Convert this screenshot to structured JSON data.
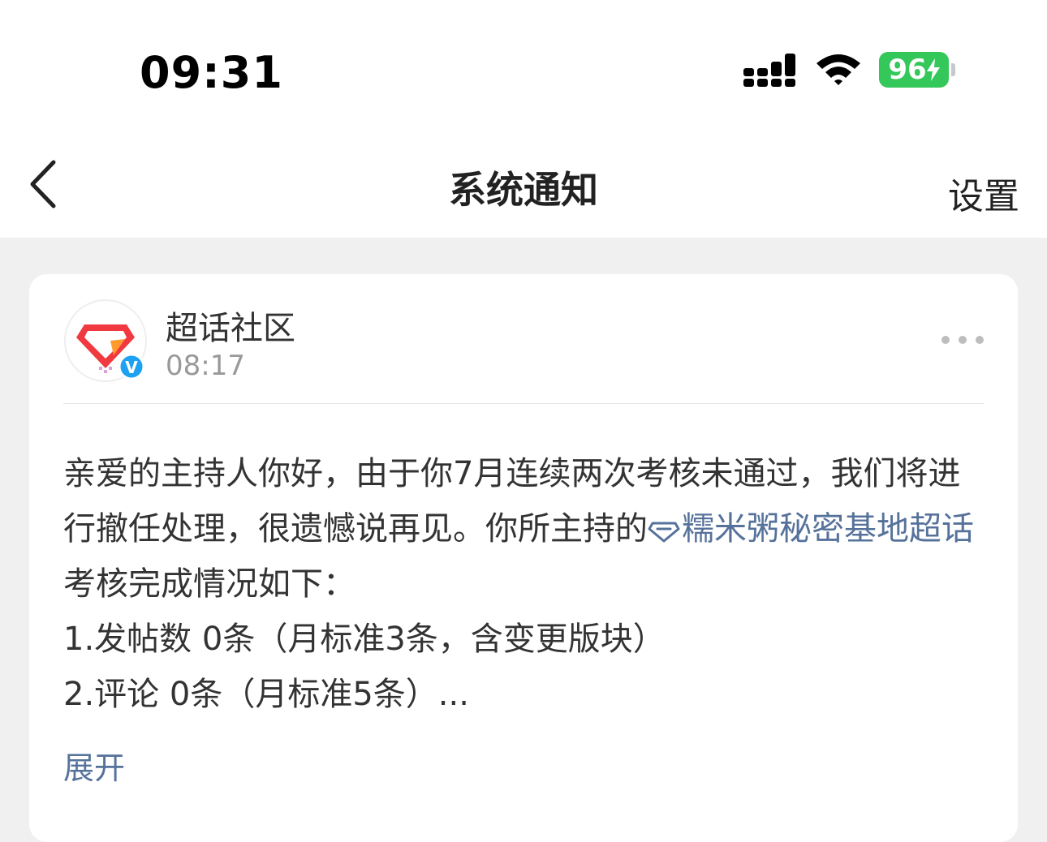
{
  "status_bar": {
    "time": "09:31",
    "battery_level": "96",
    "icons": [
      "cellular-signal-icon",
      "wifi-icon",
      "battery-charging-icon"
    ]
  },
  "nav": {
    "back_icon": "chevron-left-icon",
    "title": "系统通知",
    "settings_label": "设置"
  },
  "notification": {
    "sender": "超话社区",
    "time": "08:17",
    "verified_badge": "V",
    "more_icon": "ellipsis-icon",
    "body_intro": "亲爱的主持人你好，由于你7月连续两次考核未通过，我们将进行撤任处理，很遗憾说再见。你所主持的",
    "topic_name": "糯米粥秘密基地超话",
    "body_after_topic": "考核完成情况如下：",
    "line_1": "1.发帖数 0条（月标准3条，含变更版块）",
    "line_2": "2.评论 0条（月标准5条）...",
    "expand_label": "展开"
  },
  "colors": {
    "link": "#56729b",
    "battery": "#34c759",
    "background": "#f0f0f0",
    "card": "#ffffff",
    "verified": "#1da1f2"
  }
}
